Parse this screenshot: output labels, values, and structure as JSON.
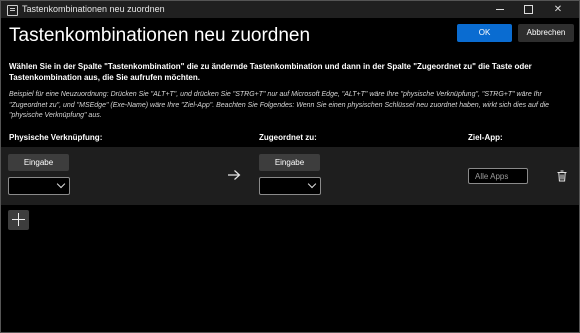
{
  "window": {
    "title": "Tastenkombinationen neu zuordnen"
  },
  "header": {
    "heading": "Tastenkombinationen neu zuordnen",
    "ok_label": "OK",
    "cancel_label": "Abbrechen"
  },
  "instructions": "Wählen Sie in der Spalte \"Tastenkombination\" die zu ändernde Tastenkombination und dann in der Spalte \"Zugeordnet zu\" die Taste oder Tastenkombination aus, die Sie aufrufen möchten.",
  "example": "Beispiel für eine Neuzuordnung: Drücken Sie \"ALT+T\", und drücken Sie \"STRG+T\" nur auf Microsoft Edge, \"ALT+T\" wäre Ihre \"physische Verknüpfung\", \"STRG+T\" wäre Ihr \"Zugeordnet zu\", und \"MSEdge\" (Exe-Name) wäre Ihre \"Ziel-App\". Beachten Sie Folgendes: Wenn Sie einen physischen Schlüssel neu zuordnet haben, wirkt sich dies auf die \"physische Verknüpfung\" aus.",
  "columns": {
    "physical": "Physische Verknüpfung:",
    "mapped": "Zugeordnet zu:",
    "target": "Ziel-App:"
  },
  "row": {
    "input_label_1": "Eingabe",
    "input_label_2": "Eingabe",
    "target_placeholder": "Alle Apps"
  },
  "icons": {
    "app": "keyboard-icon",
    "arrow": "arrow-right-icon",
    "delete": "trash-icon",
    "add": "plus-icon"
  },
  "colors": {
    "accent": "#0a6cd1",
    "background": "#000000",
    "row_background": "#1e1e1e",
    "button": "#3d3d3d"
  }
}
